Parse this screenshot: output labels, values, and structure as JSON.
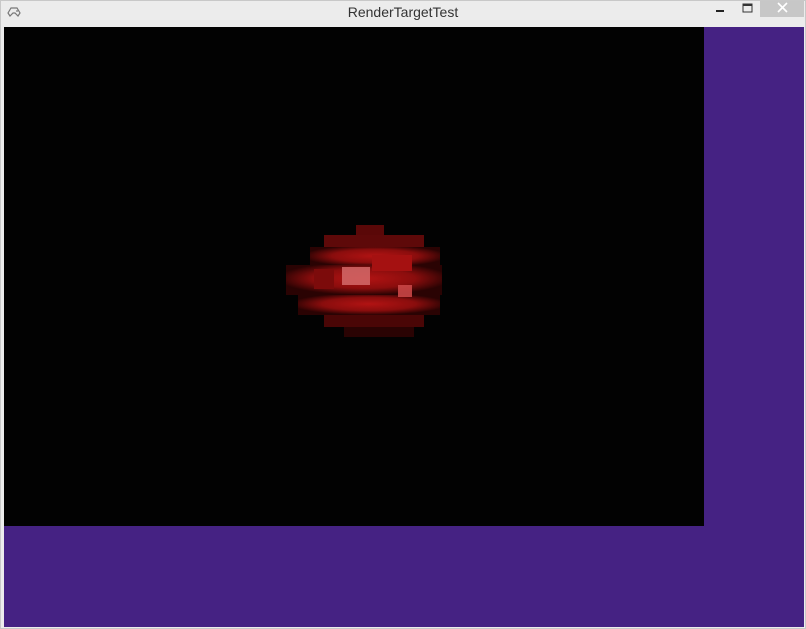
{
  "window": {
    "title": "RenderTargetTest",
    "icon": "gamepad-icon",
    "controls": {
      "minimize": "minimize-icon",
      "maximize": "maximize-icon",
      "close": "close-icon"
    }
  },
  "colors": {
    "client_background": "#452283",
    "render_target_background": "#020202",
    "sprite_dark": "#3a0505",
    "sprite_mid": "#8a0d0d",
    "sprite_bright": "#b21313",
    "sprite_highlight": "#d36a6a"
  }
}
